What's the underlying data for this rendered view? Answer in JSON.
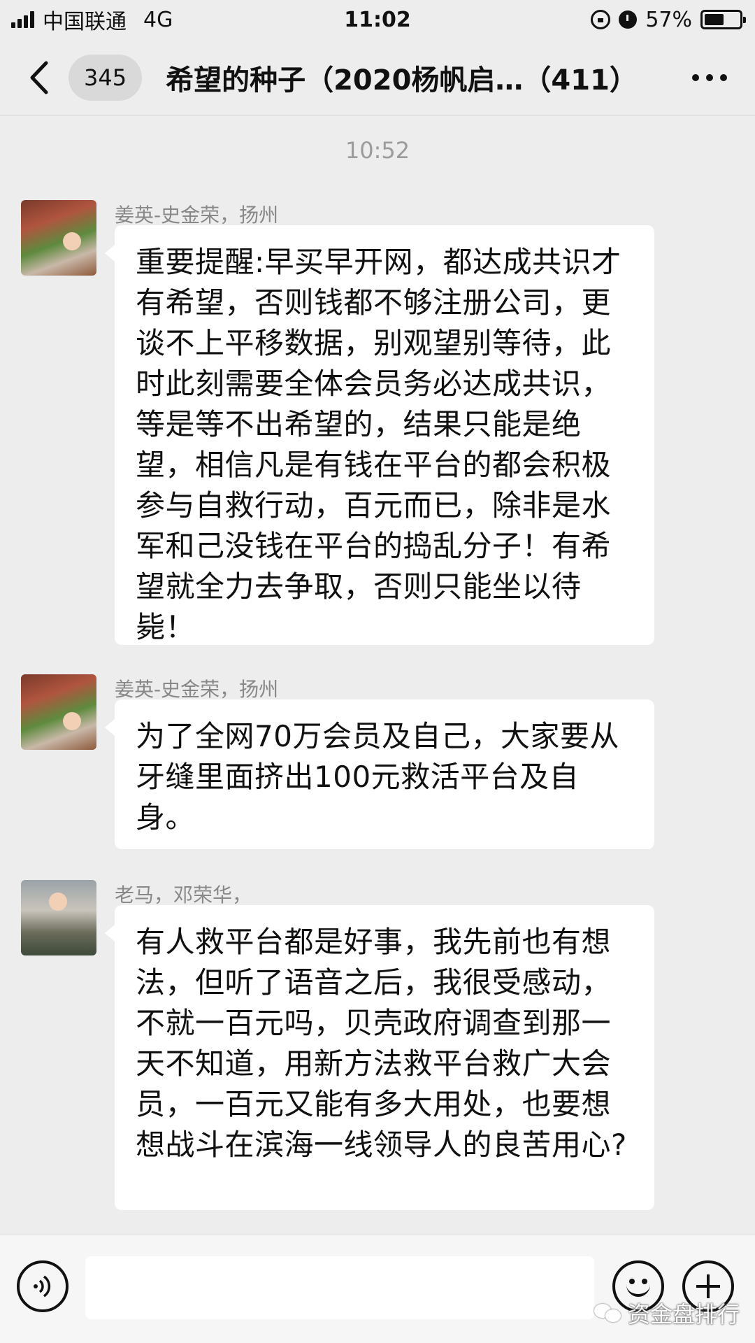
{
  "status_bar": {
    "carrier": "中国联通",
    "network": "4G",
    "time": "11:02",
    "battery_percent": "57%",
    "battery_level": 0.57
  },
  "header": {
    "back_icon": "chevron-left-icon",
    "unread_count": "345",
    "title": "希望的种子（2020杨帆启…（411）",
    "more_icon": "ellipsis-icon"
  },
  "chat": {
    "timestamp": "10:52",
    "messages": [
      {
        "sender": "姜英-史金荣，扬州",
        "avatar": "flower-avatar",
        "text": "重要提醒:早买早开网，都达成共识才有希望，否则钱都不够注册公司，更谈不上平移数据，别观望别等待，此时此刻需要全体会员务必达成共识，等是等不出希望的，结果只能是绝望，相信凡是有钱在平台的都会积极参与自救行动，百元而已，除非是水军和己没钱在平台的捣乱分子！有希望就全力去争取，否则只能坐以待毙！"
      },
      {
        "sender": "姜英-史金荣，扬州",
        "avatar": "flower-avatar",
        "text": "为了全网70万会员及自己，大家要从牙缝里面挤出100元救活平台及自身。"
      },
      {
        "sender": "老马，邓荣华，",
        "avatar": "child-avatar",
        "text": "有人救平台都是好事，我先前也有想法，但听了语音之后，我很受感动，不就一百元吗，贝壳政府调查到那一天不知道，用新方法救平台救广大会员，一百元又能有多大用处，也要想想战斗在滨海一线领导人的良苦用心?"
      }
    ]
  },
  "input_bar": {
    "voice_icon": "voice-icon",
    "emoji_icon": "emoji-icon",
    "plus_icon": "plus-icon"
  },
  "watermark": {
    "text": "资金盘排行"
  }
}
